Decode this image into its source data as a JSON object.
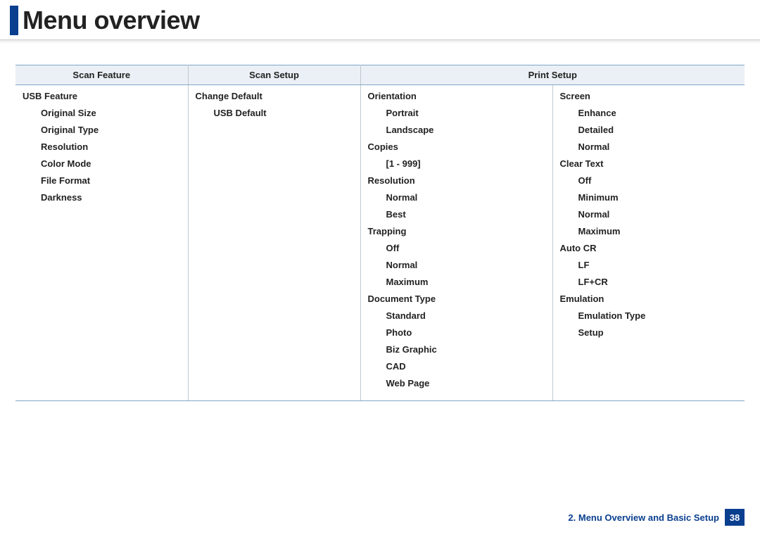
{
  "title": "Menu overview",
  "headers": {
    "col1": "Scan Feature",
    "col2": "Scan Setup",
    "col3": "Print Setup"
  },
  "col1": {
    "usb_feature": "USB Feature",
    "original_size": "Original Size",
    "original_type": "Original Type",
    "resolution": "Resolution",
    "color_mode": "Color Mode",
    "file_format": "File Format",
    "darkness": "Darkness"
  },
  "col2": {
    "change_default": "Change Default",
    "usb_default": "USB Default"
  },
  "col3a": {
    "orientation": "Orientation",
    "portrait": "Portrait",
    "landscape": "Landscape",
    "copies": "Copies",
    "copies_range": "[1 - 999]",
    "resolution": "Resolution",
    "normal": "Normal",
    "best": "Best",
    "trapping": "Trapping",
    "t_off": "Off",
    "t_normal": "Normal",
    "t_max": "Maximum",
    "document_type": "Document Type",
    "d_standard": "Standard",
    "d_photo": "Photo",
    "d_biz": "Biz Graphic",
    "d_cad": "CAD",
    "d_web": "Web Page"
  },
  "col3b": {
    "screen": "Screen",
    "enhance": "Enhance",
    "detailed": "Detailed",
    "s_normal": "Normal",
    "clear_text": "Clear Text",
    "ct_off": "Off",
    "ct_min": "Minimum",
    "ct_normal": "Normal",
    "ct_max": "Maximum",
    "auto_cr": "Auto CR",
    "lf": "LF",
    "lfcr": "LF+CR",
    "emulation": "Emulation",
    "em_type": "Emulation Type",
    "em_setup": "Setup"
  },
  "footer": {
    "text": "2. Menu Overview and Basic Setup",
    "page": "38"
  }
}
